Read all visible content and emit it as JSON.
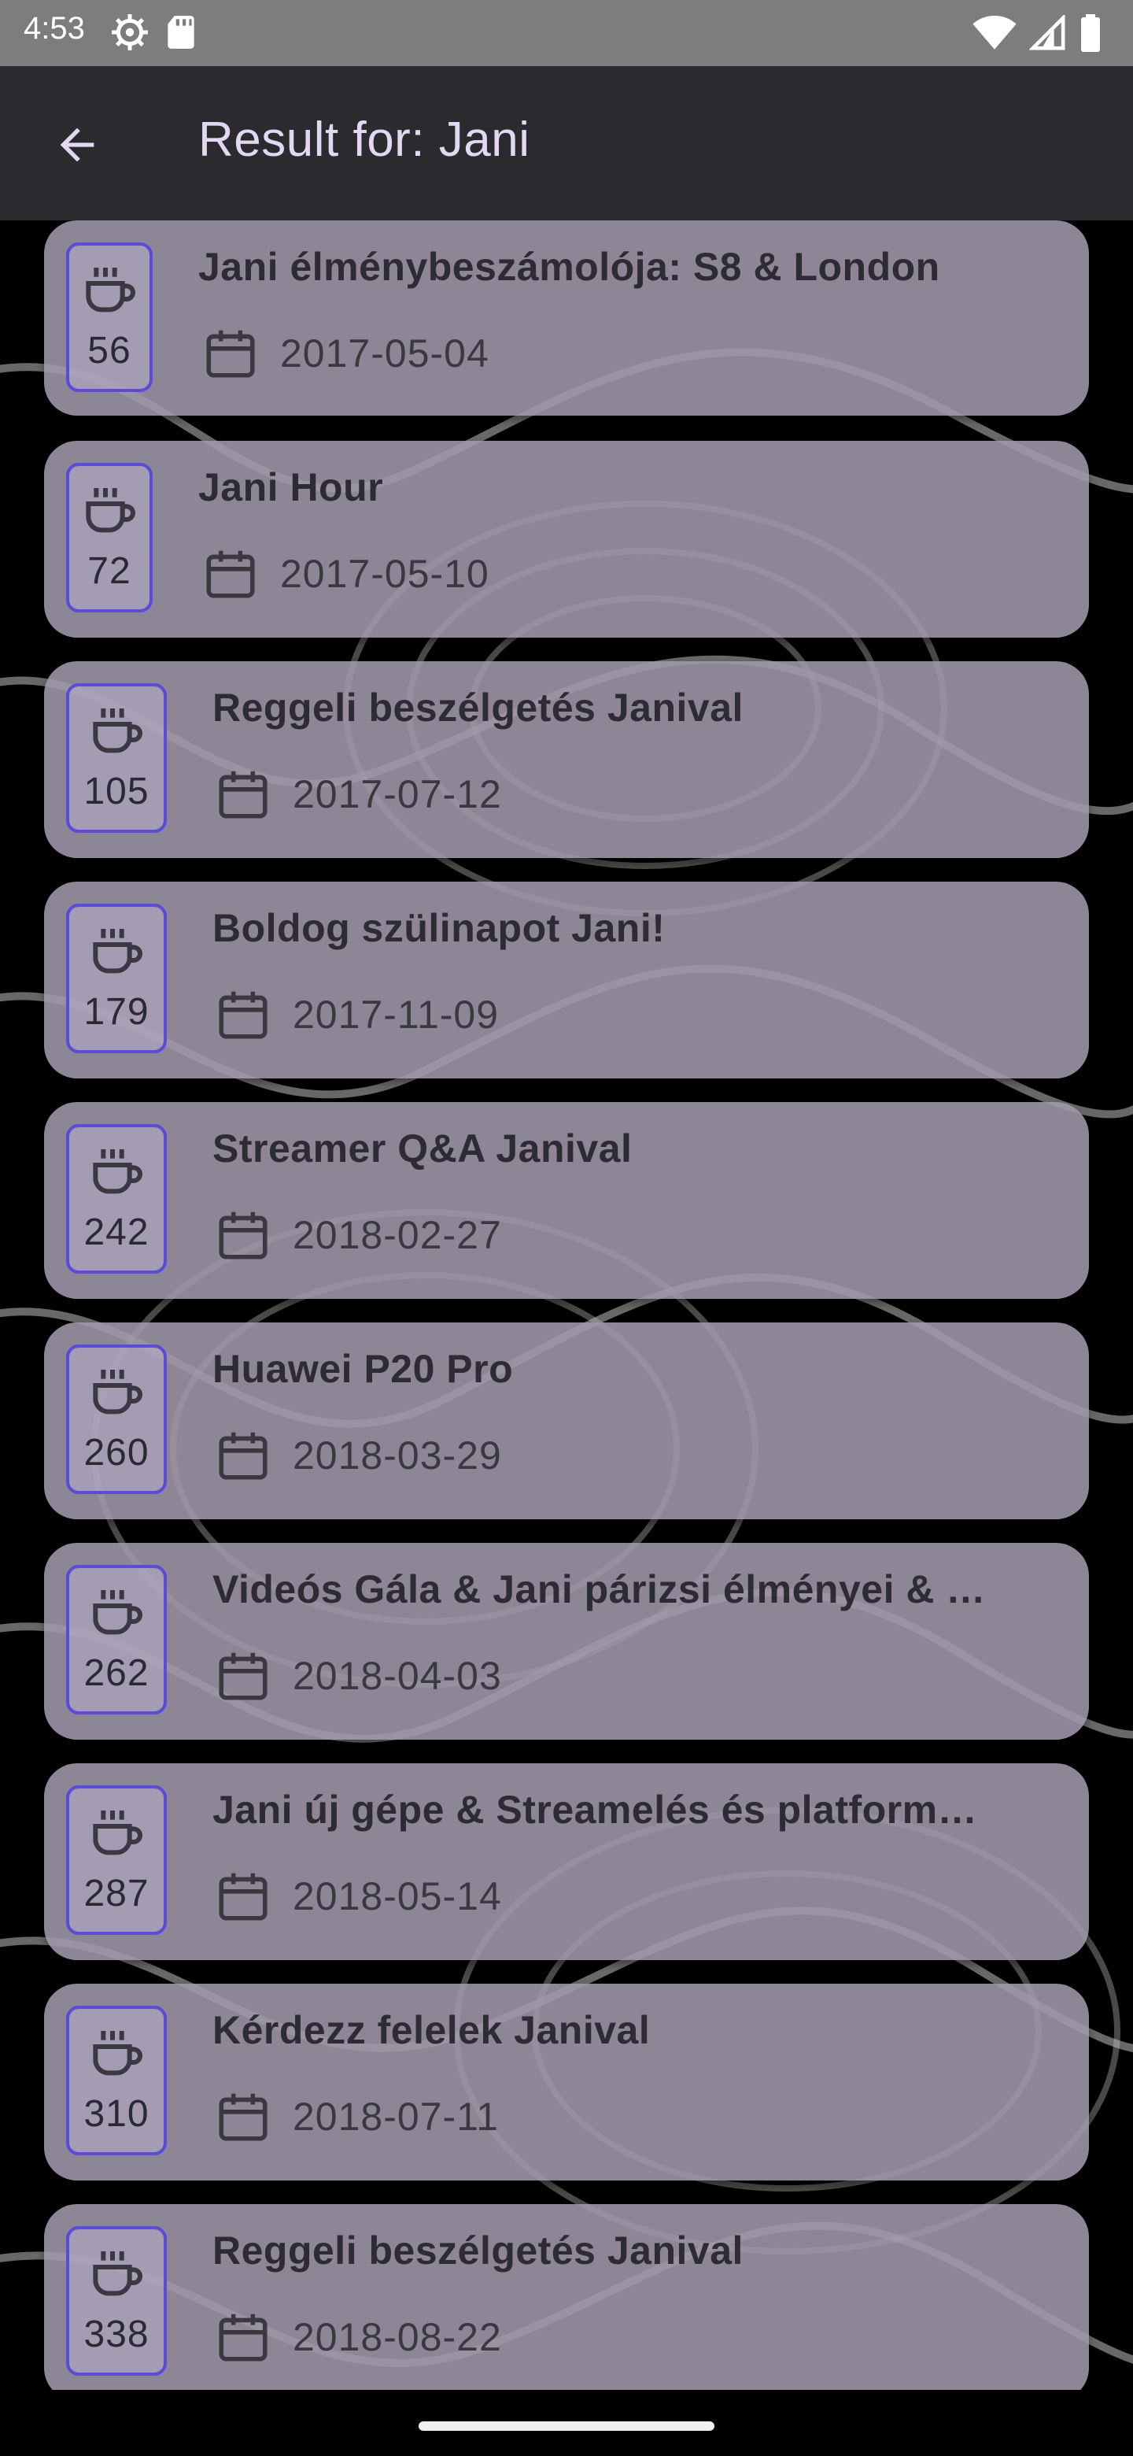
{
  "status_bar": {
    "time": "4:53"
  },
  "app_bar": {
    "title": "Result for: Jani"
  },
  "results": [
    {
      "number": "56",
      "title": "Jani élménybeszámolója: S8 & London",
      "date": "2017-05-04"
    },
    {
      "number": "72",
      "title": "Jani Hour",
      "date": "2017-05-10"
    },
    {
      "number": "105",
      "title": "Reggeli beszélgetés Janival",
      "date": "2017-07-12"
    },
    {
      "number": "179",
      "title": "Boldog szülinapot Jani!",
      "date": "2017-11-09"
    },
    {
      "number": "242",
      "title": "Streamer Q&A Janival",
      "date": "2018-02-27"
    },
    {
      "number": "260",
      "title": "Huawei P20 Pro",
      "date": "2018-03-29"
    },
    {
      "number": "262",
      "title": "Videós Gála & Jani párizsi élményei & …",
      "date": "2018-04-03"
    },
    {
      "number": "287",
      "title": "Jani új gépe & Streamelés és platform…",
      "date": "2018-05-14"
    },
    {
      "number": "310",
      "title": "Kérdezz felelek Janival",
      "date": "2018-07-11"
    },
    {
      "number": "338",
      "title": "Reggeli beszélgetés Janival",
      "date": "2018-08-22"
    }
  ],
  "icons": {
    "episode": "coffee-cup-icon",
    "date": "calendar-icon",
    "back": "arrow-back-icon"
  },
  "colors": {
    "card": "#a098ac",
    "badge_border": "#5a4cd8",
    "app_bar": "#2b2a2e",
    "title_text": "#e2d8f2"
  }
}
